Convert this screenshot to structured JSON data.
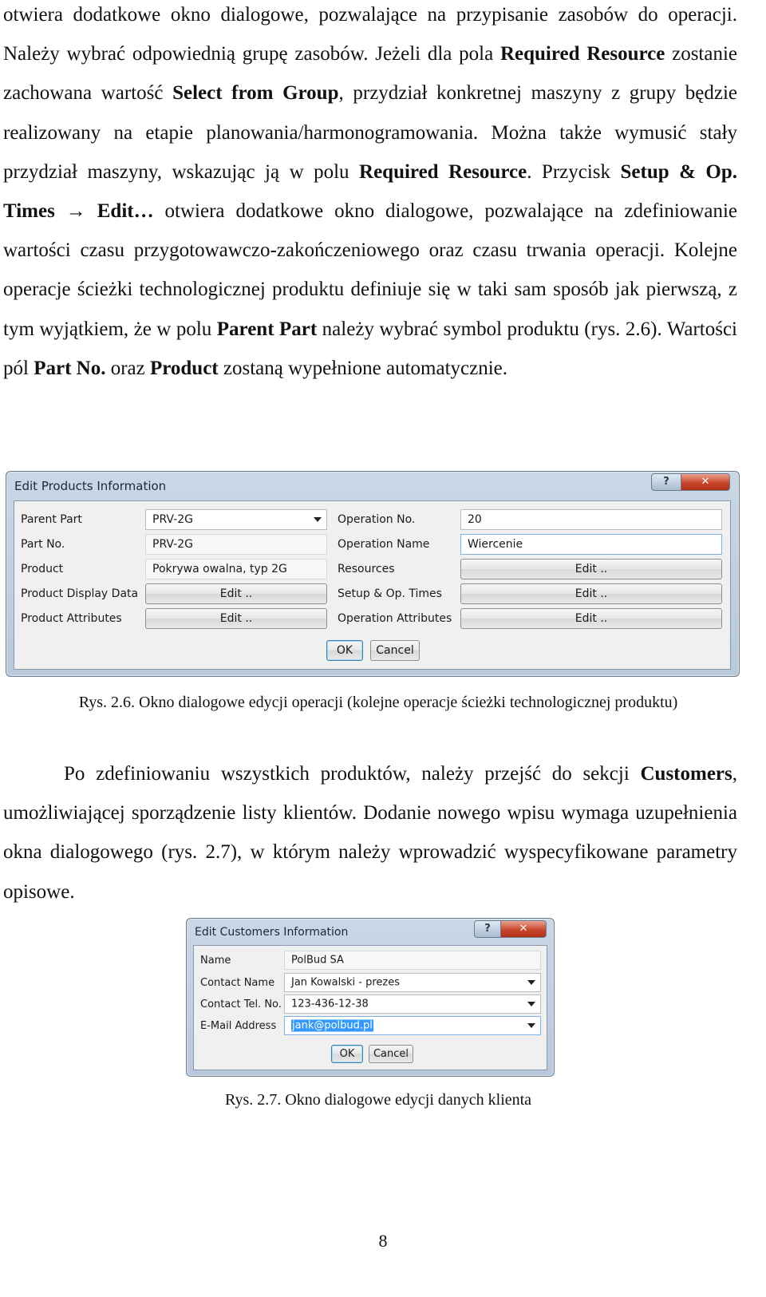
{
  "paragraph1": {
    "t1": "otwiera dodatkowe okno dialogowe, pozwalające na przypisanie zasobów do operacji. Należy wybrać odpowiednią grupę zasobów. Jeżeli dla pola ",
    "b1": "Required Resource",
    "t2": " zostanie zachowana wartość ",
    "b2": "Select from Group",
    "t3": ", przydział konkretnej maszyny z grupy będzie realizowany na etapie planowania/harmonogramowania. Można także wymusić stały przydział maszyny, wskazując ją w polu ",
    "b3": "Required Resource",
    "t4": ". Przycisk ",
    "b4": "Setup & Op. Times",
    "arrow": "→",
    "b5": "Edit…",
    "t5": " otwiera dodatkowe okno dialogowe, pozwalające na zdefiniowanie wartości czasu przygotowawczo-zakończeniowego oraz czasu trwania operacji. Kolejne operacje ścieżki technologicznej produktu definiuje się w taki sam sposób jak pierwszą, z tym wyjątkiem, że w polu ",
    "b6": "Parent Part",
    "t6": " należy wybrać symbol produktu (rys. 2.6). Wartości pól ",
    "b7": "Part No.",
    "t7": " oraz ",
    "b8": "Product",
    "t8": " zostaną wypełnione automatycznie."
  },
  "dialog1": {
    "title": "Edit Products Information",
    "help_label": "?",
    "close_label": "✕",
    "labels": {
      "parent_part": "Parent Part",
      "part_no": "Part No.",
      "product": "Product",
      "product_display_data": "Product Display Data",
      "product_attributes": "Product Attributes",
      "operation_no": "Operation No.",
      "operation_name": "Operation Name",
      "resources": "Resources",
      "setup_op_times": "Setup & Op. Times",
      "operation_attributes": "Operation Attributes"
    },
    "values": {
      "parent_part": "PRV-2G",
      "part_no": "PRV-2G",
      "product": "Pokrywa owalna, typ 2G",
      "operation_no": "20",
      "operation_name": "Wiercenie"
    },
    "edit_label": "Edit ..",
    "ok_label": "OK",
    "cancel_label": "Cancel"
  },
  "caption1": "Rys. 2.6. Okno dialogowe edycji operacji (kolejne operacje ścieżki technologicznej produktu)",
  "paragraph2": {
    "t1": "Po zdefiniowaniu wszystkich produktów, należy przejść do sekcji ",
    "b1": "Customers",
    "t2": ", umożliwiającej sporządzenie listy klientów. Dodanie nowego wpisu wymaga uzupełnienia okna dialogowego (rys. 2.7), w którym należy wprowadzić wyspecyfikowane parametry opisowe."
  },
  "dialog2": {
    "title": "Edit Customers Information",
    "help_label": "?",
    "close_label": "✕",
    "labels": {
      "name": "Name",
      "contact_name": "Contact Name",
      "contact_tel": "Contact Tel. No.",
      "email": "E-Mail Address"
    },
    "values": {
      "name": "PolBud SA",
      "contact_name": "Jan Kowalski - prezes",
      "contact_tel": "123-436-12-38",
      "email": "jank@polbud.pl"
    },
    "ok_label": "OK",
    "cancel_label": "Cancel"
  },
  "caption2": "Rys. 2.7. Okno dialogowe edycji danych klienta",
  "page_number": "8"
}
